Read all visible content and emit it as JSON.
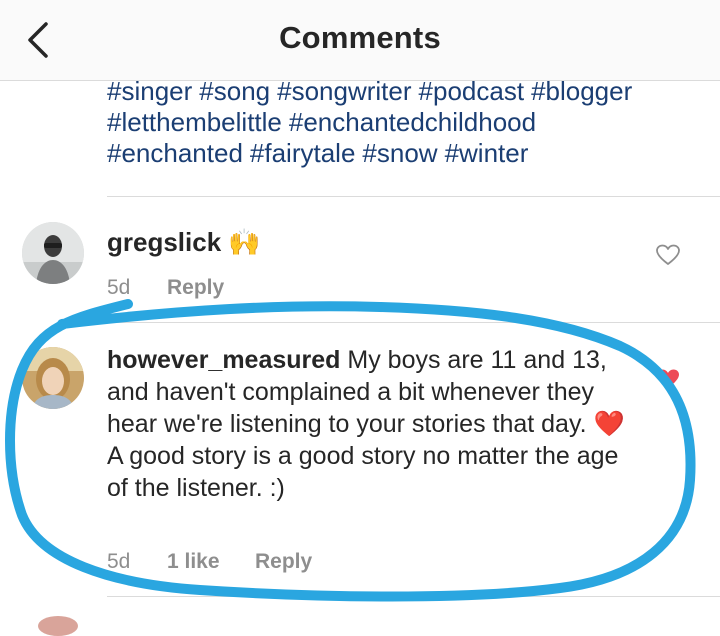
{
  "header": {
    "title": "Comments"
  },
  "caption": {
    "hashtags": [
      [
        "#singer",
        "#song",
        "#songwriter",
        "#podcast",
        "#blogger"
      ],
      [
        "#letthembelittle",
        "#enchantedchildhood"
      ],
      [
        "#enchanted",
        "#fairytale",
        "#snow",
        "#winter"
      ]
    ]
  },
  "comments": [
    {
      "username": "gregslick",
      "text": "🙌",
      "time": "5d",
      "reply": "Reply",
      "liked": false
    },
    {
      "username": "however_measured",
      "text": "My boys are 11 and 13, and haven't complained a bit whenever they hear we're listening to your stories that day. ❤️  A good story is a good story no matter the age of the listener. :)",
      "time": "5d",
      "likes": "1 like",
      "reply": "Reply",
      "liked": true
    }
  ],
  "colors": {
    "hashtag": "#1b3e73",
    "annotation_circle": "#2aa6e0",
    "like_heart": "#ed4956"
  },
  "icons": {
    "back": "chevron-left-icon",
    "like": "heart-icon"
  }
}
